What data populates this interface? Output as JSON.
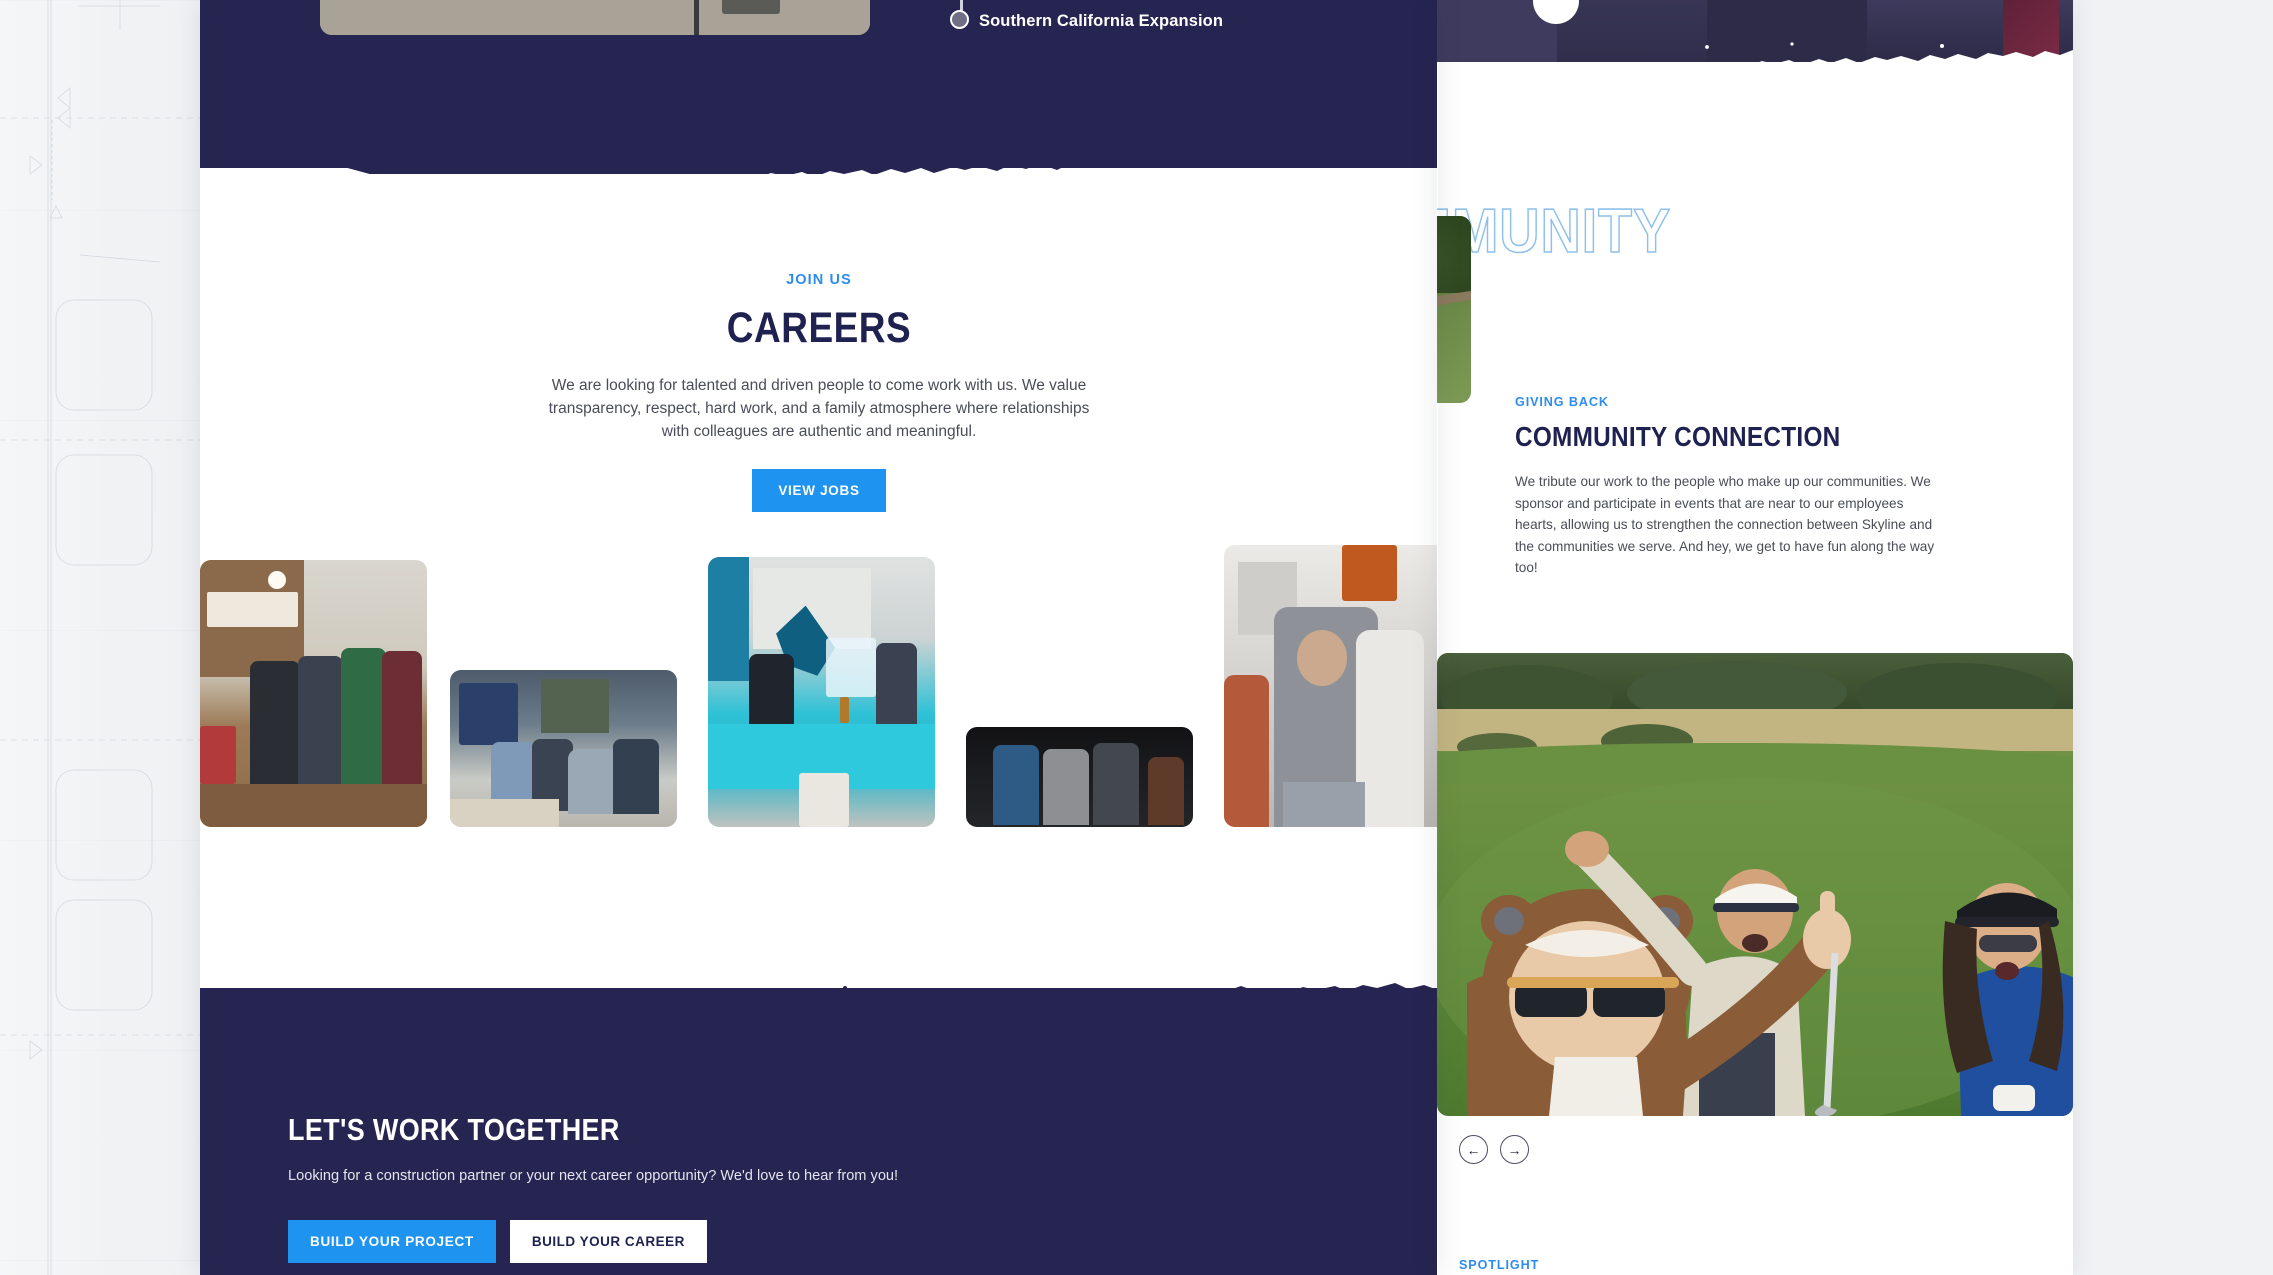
{
  "timeline": {
    "marker_label": "Southern California Expansion"
  },
  "careers": {
    "eyebrow": "JOIN US",
    "heading": "CAREERS",
    "body": "We are looking for talented and driven people to come work with us. We value transparency, respect, hard work, and a family atmosphere where relationships with colleagues are authentic and meaningful.",
    "cta_label": "VIEW JOBS",
    "gallery": [
      {
        "name": "holiday-sweater-party",
        "caption": "SKYLINE Construction office holiday sweater group"
      },
      {
        "name": "office-lunch-gathering",
        "caption": "Team seated at office tables"
      },
      {
        "name": "sharks-ice-sculpture-event",
        "caption": "Sharks themed event with Skyline ice sculpture"
      },
      {
        "name": "evening-team-photo",
        "caption": "Group photo at evening event"
      },
      {
        "name": "celebration-high-five",
        "caption": "Colleagues celebrating with raised arms"
      }
    ]
  },
  "cta_section": {
    "heading": "LET'S WORK TOGETHER",
    "subtext": "Looking for a construction partner or your next career opportunity? We'd love to hear from you!",
    "primary_label": "BUILD YOUR PROJECT",
    "secondary_label": "BUILD YOUR CAREER"
  },
  "community": {
    "outline_heading": "COMMUNITY",
    "eyebrow": "GIVING BACK",
    "heading": "COMMUNITY CONNECTION",
    "body": "We tribute our work to the people who make up our communities. We sponsor and participate in events that are near to our employees hearts, allowing us to strengthen the connection between Skyline and the communities we serve. And hey, we get to have fun along the way too!",
    "feature_image_caption": "Three colleagues posing on a golf course",
    "prev_label": "←",
    "next_label": "→",
    "spotlight_label": "SPOTLIGHT"
  },
  "colors": {
    "navy": "#262450",
    "accent_blue": "#1e93f0",
    "eyebrow_blue": "#2d8cf0",
    "outline_blue": "#8fc0ec",
    "page_bg": "#f1f2f4",
    "panel_bg": "#ffffff"
  }
}
